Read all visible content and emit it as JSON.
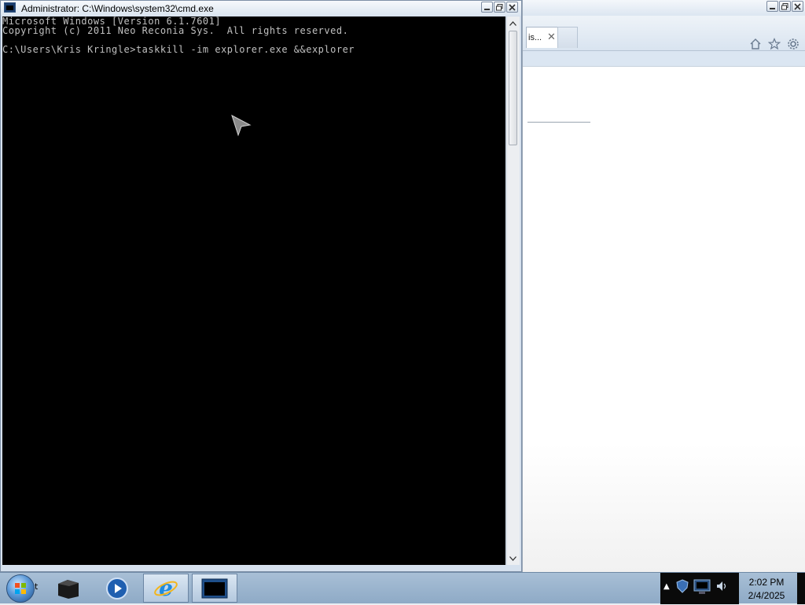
{
  "browser_window": {
    "tab_label": "is...",
    "tools": [
      "home-icon",
      "star-icon",
      "gear-icon"
    ]
  },
  "cmd_window": {
    "title": "Administrator: C:\\Windows\\system32\\cmd.exe",
    "lines": [
      "Microsoft Windows [Version 6.1.7601]",
      "Copyright (c) 2011 Neo Reconia Sys.  All rights reserved.",
      "",
      "C:\\Users\\Kris Kringle>taskkill -im explorer.exe &&explorer"
    ]
  },
  "taskbar": {
    "start_label": "t",
    "pinned": [
      {
        "name": "file-cabinet-icon",
        "active": false
      },
      {
        "name": "media-player-icon",
        "active": false
      },
      {
        "name": "internet-explorer-icon",
        "active": true
      },
      {
        "name": "cmd-icon",
        "active": true
      }
    ],
    "clock": {
      "time": "2:02 PM",
      "date": "2/4/2025"
    }
  },
  "colors": {
    "console_bg": "#000000",
    "console_text": "#c0c0c0",
    "taskbar": "#9fb7cf"
  }
}
